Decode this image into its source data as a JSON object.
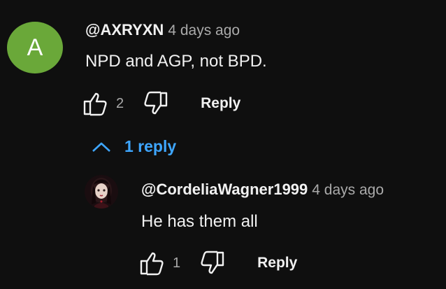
{
  "comment": {
    "avatar_letter": "A",
    "avatar_color": "#6aa839",
    "author": "@AXRYXN",
    "time": "4 days ago",
    "text": "NPD and AGP, not BPD.",
    "likes": "2",
    "reply_label": "Reply"
  },
  "replies_toggle": {
    "label": "1 reply",
    "color": "#3ea6ff",
    "icon": "chevron-up-icon"
  },
  "reply": {
    "author": "@CordeliaWagner1999",
    "time": "4 days ago",
    "text": "He has them all",
    "likes": "1",
    "reply_label": "Reply"
  },
  "icons": {
    "like": "thumbs-up-icon",
    "dislike": "thumbs-down-icon"
  }
}
